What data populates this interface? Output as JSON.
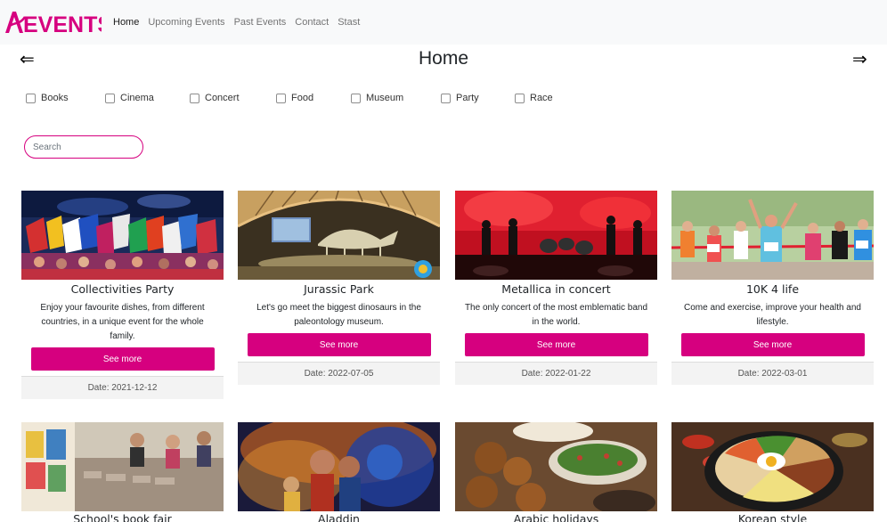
{
  "brand": {
    "logo_text": "EVENTS",
    "logo_color": "#d6007f"
  },
  "nav": {
    "links": [
      {
        "label": "Home",
        "active": true
      },
      {
        "label": "Upcoming Events",
        "active": false
      },
      {
        "label": "Past Events",
        "active": false
      },
      {
        "label": "Contact",
        "active": false
      },
      {
        "label": "Stast",
        "active": false
      }
    ]
  },
  "page": {
    "title": "Home",
    "prev_arrow": "⇐",
    "next_arrow": "⇒"
  },
  "filters": [
    "Books",
    "Cinema",
    "Concert",
    "Food",
    "Museum",
    "Party",
    "Race"
  ],
  "search": {
    "placeholder": "Search",
    "value": ""
  },
  "accent_color": "#d6007f",
  "cards": [
    {
      "title": "Collectivities Party",
      "text": "Enjoy your favourite dishes, from different countries, in a unique event for the whole family.",
      "button": "See more",
      "date": "Date: 2021-12-12",
      "image": "flags-stage-photo"
    },
    {
      "title": "Jurassic Park",
      "text": "Let's go meet the biggest dinosaurs in the paleontology museum.",
      "button": "See more",
      "date": "Date: 2022-07-05",
      "image": "dinosaur-museum-photo"
    },
    {
      "title": "Metallica in concert",
      "text": "The only concert of the most emblematic band in the world.",
      "button": "See more",
      "date": "Date: 2022-01-22",
      "image": "concert-stage-photo"
    },
    {
      "title": "10K 4 life",
      "text": "Come and exercise, improve your health and lifestyle.",
      "button": "See more",
      "date": "Date: 2022-03-01",
      "image": "runners-finish-photo"
    }
  ],
  "cards_row2": [
    {
      "title": "School's book fair",
      "image": "book-fair-photo"
    },
    {
      "title": "Aladdin",
      "image": "aladdin-poster-photo"
    },
    {
      "title": "Arabic holidays",
      "image": "arabic-food-photo"
    },
    {
      "title": "Korean style",
      "image": "korean-bibimbap-photo"
    }
  ]
}
